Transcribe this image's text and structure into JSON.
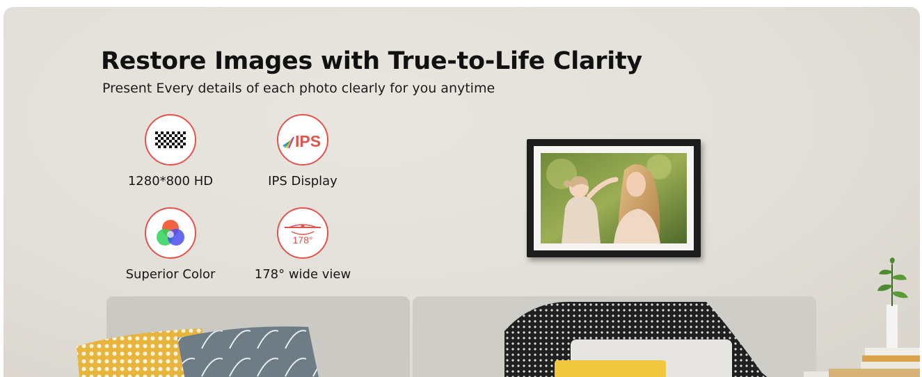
{
  "headline": "Restore Images with True-to-Life Clarity",
  "subheadline": "Present Every details of each photo clearly for you anytime",
  "features": [
    {
      "label": "1280*800 HD",
      "icon": "checkerboard-icon"
    },
    {
      "label": "IPS Display",
      "icon": "ips-logo-icon",
      "icon_text": "IPS"
    },
    {
      "label": "Superior Color",
      "icon": "rgb-circles-icon"
    },
    {
      "label": "178° wide view",
      "icon": "viewing-angle-icon",
      "icon_text": "178°"
    }
  ],
  "colors": {
    "accent": "#e2534b",
    "wall": "#e4e1db",
    "headline": "#111111",
    "frame": "#1d1d1d"
  }
}
